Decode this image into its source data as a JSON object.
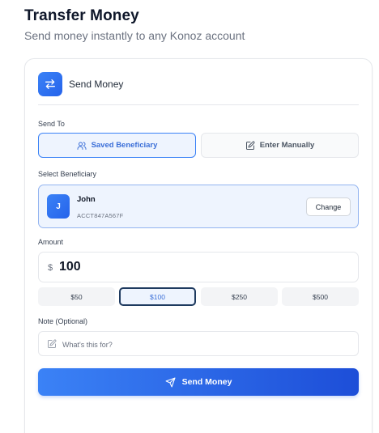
{
  "page": {
    "title": "Transfer Money",
    "subtitle": "Send money instantly to any Konoz account"
  },
  "card": {
    "title": "Send Money",
    "header_icon": "transfer-arrows-icon"
  },
  "send_to": {
    "label": "Send To",
    "options": [
      {
        "label": "Saved Beneficiary",
        "icon": "users-icon",
        "selected": true
      },
      {
        "label": "Enter Manually",
        "icon": "edit-icon",
        "selected": false
      }
    ]
  },
  "beneficiary": {
    "label": "Select Beneficiary",
    "initial": "J",
    "name": "John",
    "account": "ACCT847A567F",
    "change_label": "Change"
  },
  "amount": {
    "label": "Amount",
    "currency_symbol": "$",
    "value": "100",
    "quick_options": [
      "$50",
      "$100",
      "$250",
      "$500"
    ],
    "selected_quick": "$100"
  },
  "note": {
    "label": "Note (Optional)",
    "placeholder": "What's this for?",
    "value": ""
  },
  "submit": {
    "label": "Send Money",
    "icon": "send-icon"
  },
  "colors": {
    "accent": "#3b82f6",
    "accent_dark": "#1d4ed8",
    "selected_bg": "#eef4fe",
    "selected_quick_border": "#1e3a5f"
  }
}
